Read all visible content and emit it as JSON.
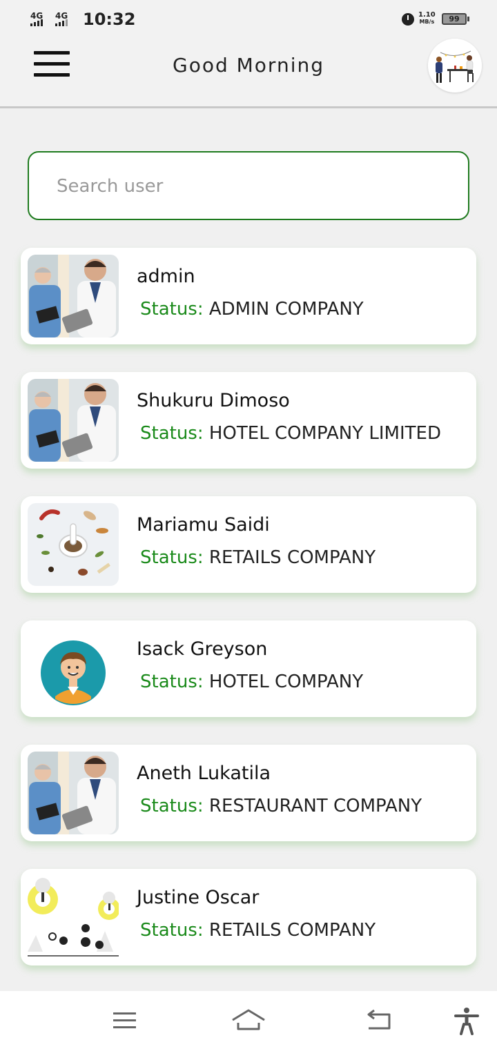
{
  "status_bar": {
    "sim1": "4G",
    "sim2": "4G",
    "time": "10:32",
    "speed_value": "1.10",
    "speed_unit": "MB/s",
    "battery": "99"
  },
  "header": {
    "title": "Good Morning",
    "menu_icon": "hamburger-menu-icon",
    "avatar_icon": "profile-avatar-illustration"
  },
  "search": {
    "placeholder": "Search user",
    "value": ""
  },
  "colors": {
    "accent": "#1e7a1e",
    "status_label": "#1a8a1a",
    "background": "#f0f0f0"
  },
  "users": [
    {
      "name": "admin",
      "status_label": "Status:",
      "status": "ADMIN COMPANY",
      "photo": "doctors-photo"
    },
    {
      "name": "Shukuru Dimoso",
      "status_label": "Status:",
      "status": "HOTEL COMPANY LIMITED",
      "photo": "doctors-photo"
    },
    {
      "name": "Mariamu Saidi",
      "status_label": "Status:",
      "status": "RETAILS COMPANY",
      "photo": "spices-photo"
    },
    {
      "name": "Isack Greyson",
      "status_label": "Status:",
      "status": "HOTEL COMPANY",
      "photo": "man-avatar-icon"
    },
    {
      "name": "Aneth Lukatila",
      "status_label": "Status:",
      "status": "RESTAURANT COMPANY",
      "photo": "doctors-photo"
    },
    {
      "name": "Justine Oscar",
      "status_label": "Status:",
      "status": "RETAILS COMPANY",
      "photo": "cartoon-illustration"
    }
  ],
  "nav": {
    "items": [
      "menu-icon",
      "home-icon",
      "back-icon",
      "accessibility-icon"
    ]
  }
}
